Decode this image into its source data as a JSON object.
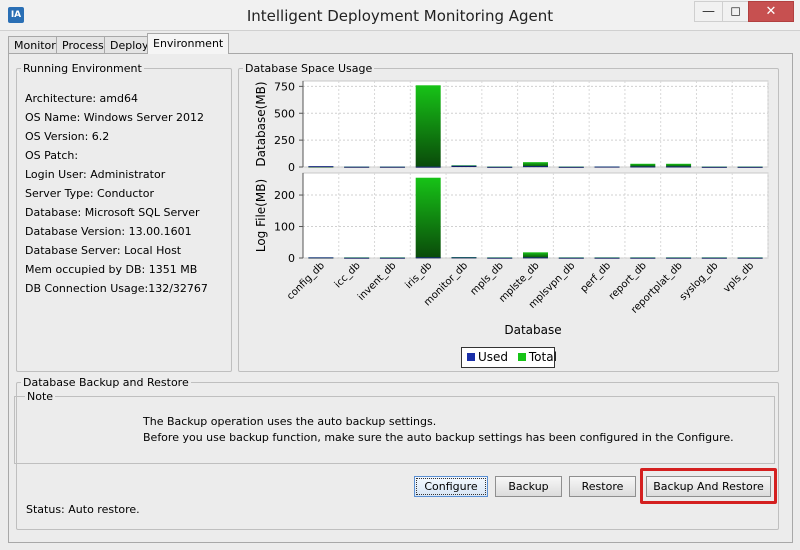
{
  "window": {
    "title": "Intelligent Deployment Monitoring Agent",
    "minimize_glyph": "—",
    "maximize_glyph": "◻",
    "close_glyph": "✕",
    "icon": "app-icon",
    "icon_text": "IA"
  },
  "tabs": [
    {
      "label": "Monitor"
    },
    {
      "label": "Process"
    },
    {
      "label": "Deploy"
    },
    {
      "label": "Environment"
    }
  ],
  "running_env": {
    "title": "Running Environment",
    "items": [
      "Architecture: amd64",
      "OS Name: Windows Server 2012",
      "OS Version: 6.2",
      "OS Patch:",
      "Login User: Administrator",
      "Server Type: Conductor",
      "Database: Microsoft SQL Server",
      "Database Version: 13.00.1601",
      "Database Server: Local Host",
      "Mem occupied by DB: 1351 MB",
      "DB Connection Usage:132/32767"
    ]
  },
  "space_usage": {
    "title": "Database Space Usage",
    "legend": {
      "used": "Used",
      "total": "Total"
    }
  },
  "chart_data": {
    "type": "bar",
    "categories": [
      "config_db",
      "icc_db",
      "invent_db",
      "iris_db",
      "monitor_db",
      "mpls_db",
      "mplste_db",
      "mplsvpn_db",
      "perf_db",
      "report_db",
      "reportplat_db",
      "syslog_db",
      "vpls_db"
    ],
    "xlabel": "Database",
    "legend_placement": "bottom",
    "grid": true,
    "colors": {
      "used": "#1a2fa8",
      "total": "#17c317"
    },
    "panels": [
      {
        "ylabel": "Database(MB)",
        "ylim": [
          0,
          800
        ],
        "yticks": [
          0,
          250,
          500,
          750
        ],
        "series": [
          {
            "name": "Used",
            "values": [
              8,
              3,
              3,
              3,
              12,
              2,
              8,
              2,
              4,
              5,
              5,
              2,
              2
            ]
          },
          {
            "name": "Total",
            "values": [
              5,
              4,
              4,
              760,
              16,
              4,
              45,
              4,
              5,
              30,
              30,
              4,
              4
            ]
          }
        ]
      },
      {
        "ylabel": "Log File(MB)",
        "ylim": [
          0,
          270
        ],
        "yticks": [
          0,
          100,
          200
        ],
        "series": [
          {
            "name": "Used",
            "values": [
              2,
              1,
              1,
              2,
              2,
              1,
              2,
              1,
              1,
              1,
              1,
              1,
              1
            ]
          },
          {
            "name": "Total",
            "values": [
              2,
              2,
              2,
              255,
              3,
              2,
              18,
              2,
              2,
              2,
              2,
              2,
              2
            ]
          }
        ]
      }
    ]
  },
  "backup": {
    "title": "Database Backup and Restore",
    "note_title": "Note",
    "note_lines": [
      "The Backup operation uses the auto backup settings.",
      "Before you use backup function, make sure the auto backup settings has been configured in the Configure."
    ],
    "buttons": {
      "configure": "Configure",
      "backup": "Backup",
      "restore": "Restore",
      "backup_restore": "Backup And Restore"
    },
    "status": "Status: Auto restore."
  }
}
